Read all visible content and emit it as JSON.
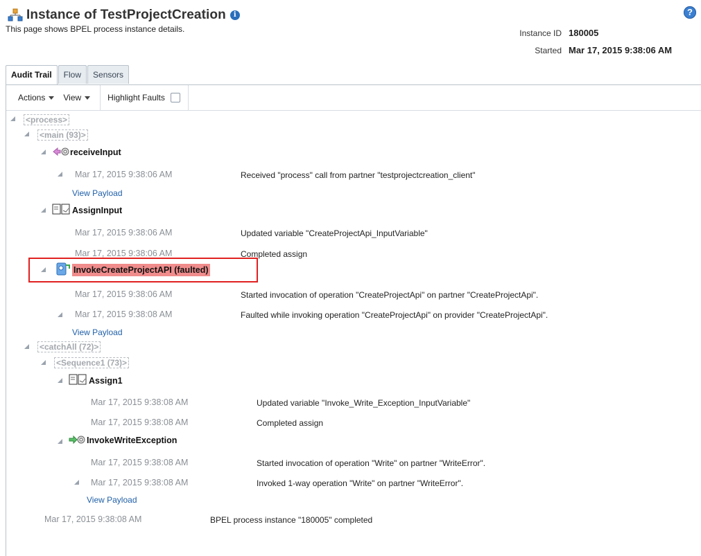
{
  "header": {
    "title": "Instance of TestProjectCreation",
    "subtitle": "This page shows BPEL process instance details.",
    "instance_id_label": "Instance ID",
    "instance_id_value": "180005",
    "started_label": "Started",
    "started_value": "Mar 17, 2015 9:38:06 AM",
    "help_icon": "help-icon",
    "info_icon": "info-icon"
  },
  "tabs": [
    {
      "label": "Audit Trail",
      "active": true
    },
    {
      "label": "Flow",
      "active": false
    },
    {
      "label": "Sensors",
      "active": false
    }
  ],
  "toolbar": {
    "actions_label": "Actions",
    "view_label": "View",
    "highlight_label": "Highlight Faults",
    "highlight_checked": false
  },
  "colors": {
    "fault_highlight": "#f08c8c",
    "fault_border": "#e02020",
    "link": "#1f5fa8"
  },
  "tree": {
    "process_tag": "<process>",
    "main_tag": "<main (93)>",
    "receive": {
      "name": "receiveInput",
      "icon": "receive-icon",
      "time": "Mar 17, 2015 9:38:06 AM",
      "msg": "Received \"process\" call from partner \"testprojectcreation_client\"",
      "link": "View Payload"
    },
    "assign_input": {
      "name": "AssignInput",
      "icon": "assign-icon",
      "rows": [
        {
          "time": "Mar 17, 2015 9:38:06 AM",
          "msg": "Updated variable \"CreateProjectApi_InputVariable\""
        },
        {
          "time": "Mar 17, 2015 9:38:06 AM",
          "msg": "Completed assign"
        }
      ]
    },
    "invoke_api": {
      "name": "InvokeCreateProjectAPI (faulted)",
      "icon": "invoke-icon",
      "rows": [
        {
          "time": "Mar 17, 2015 9:38:06 AM",
          "msg": "Started invocation of operation \"CreateProjectApi\" on partner \"CreateProjectApi\"."
        },
        {
          "time": "Mar 17, 2015 9:38:08 AM",
          "msg": "Faulted while invoking operation \"CreateProjectApi\" on provider \"CreateProjectApi\"."
        }
      ],
      "link": "View Payload"
    },
    "catch_tag": "<catchAll (72)>",
    "seq_tag": "<Sequence1 (73)>",
    "assign1": {
      "name": "Assign1",
      "icon": "assign-icon",
      "rows": [
        {
          "time": "Mar 17, 2015 9:38:08 AM",
          "msg": "Updated variable \"Invoke_Write_Exception_InputVariable\""
        },
        {
          "time": "Mar 17, 2015 9:38:08 AM",
          "msg": "Completed assign"
        }
      ]
    },
    "invoke_write": {
      "name": "InvokeWriteException",
      "icon": "invoke-arrow-icon",
      "rows": [
        {
          "time": "Mar 17, 2015 9:38:08 AM",
          "msg": "Started invocation of operation \"Write\" on partner \"WriteError\"."
        },
        {
          "time": "Mar 17, 2015 9:38:08 AM",
          "msg": "Invoked 1-way operation \"Write\" on partner \"WriteError\"."
        }
      ],
      "link": "View Payload"
    },
    "final": {
      "time": "Mar 17, 2015 9:38:08 AM",
      "msg": "BPEL process instance \"180005\" completed"
    }
  }
}
